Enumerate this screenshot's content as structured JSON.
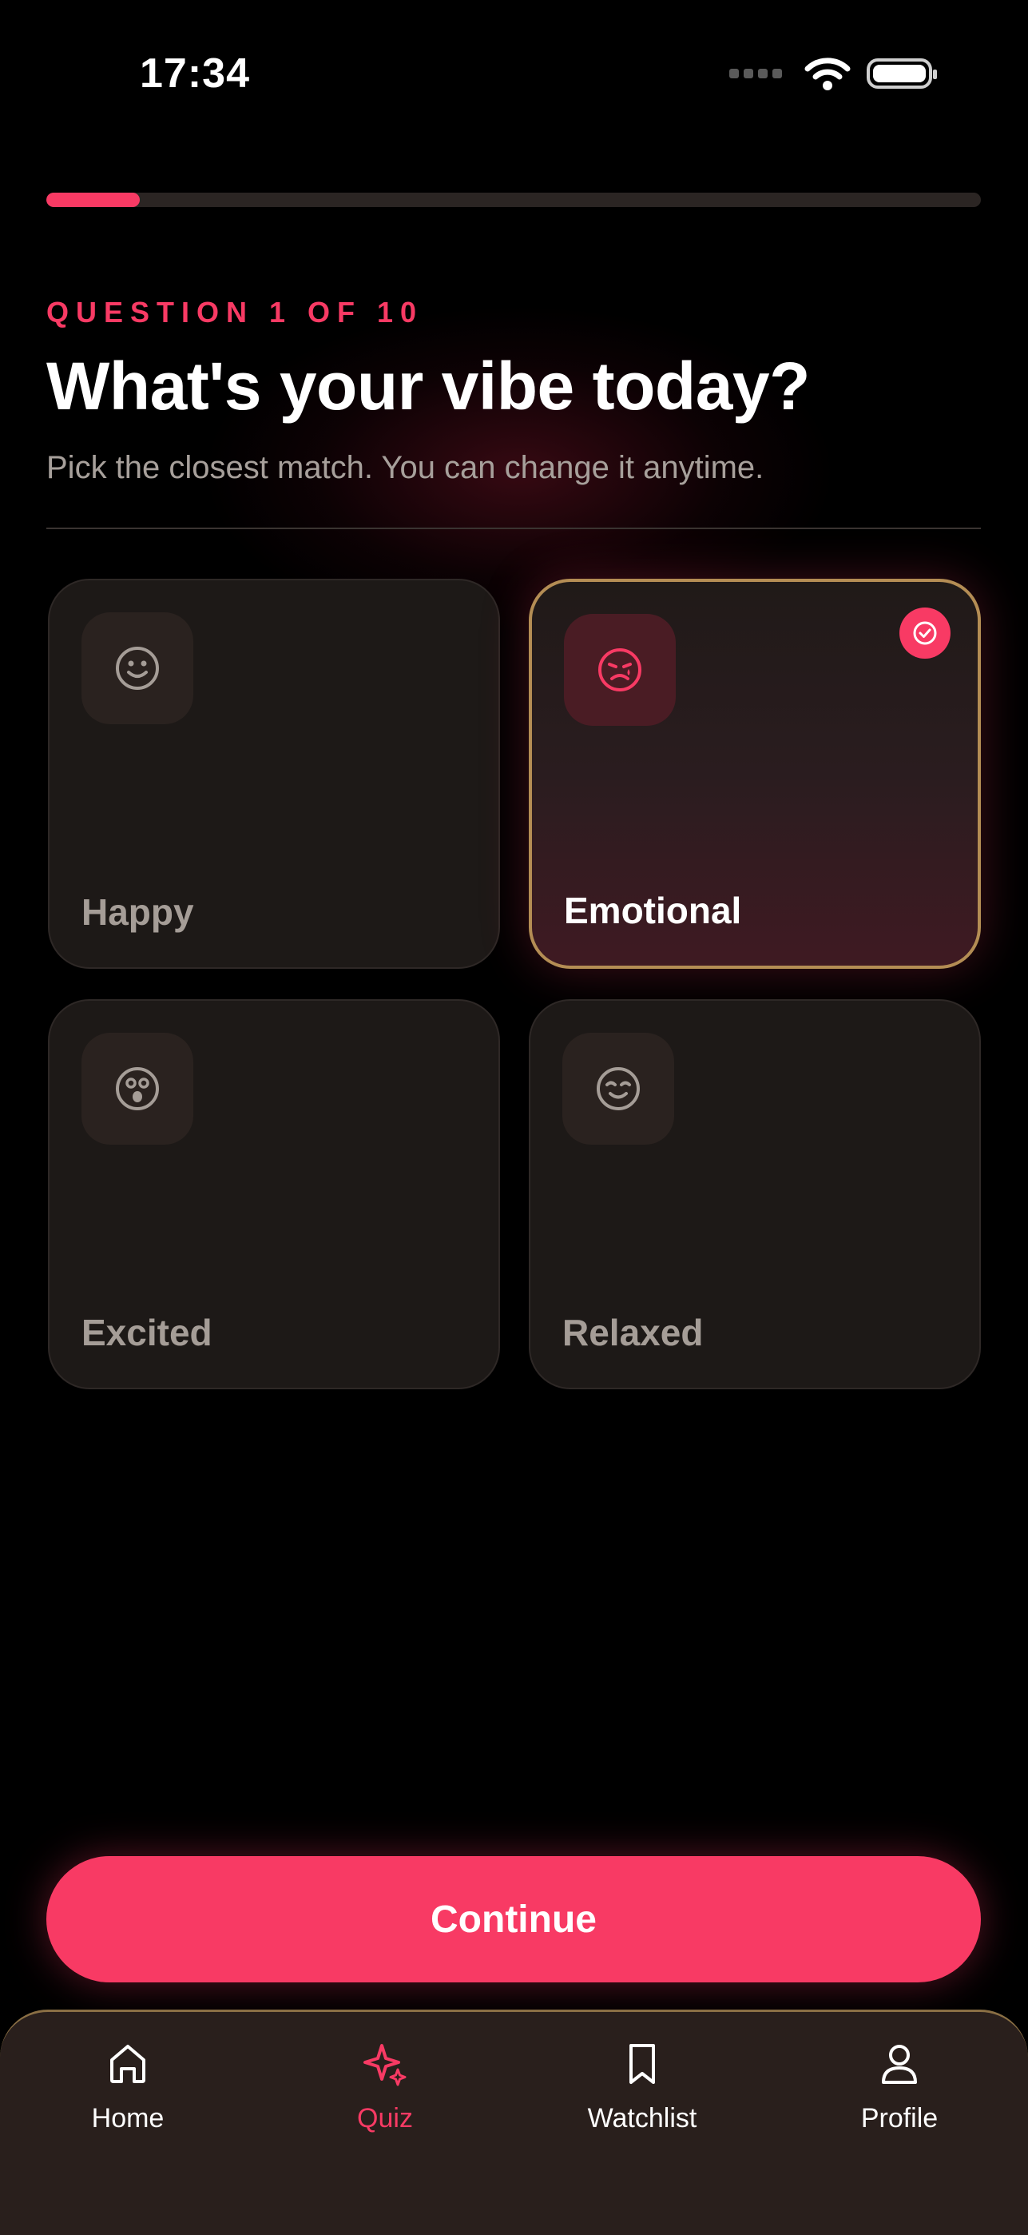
{
  "status_bar": {
    "time": "17:34"
  },
  "progress": {
    "current": 1,
    "total": 10,
    "fraction": 0.1
  },
  "question": {
    "eyebrow": "QUESTION 1 OF 10",
    "title": "What's your vibe today?",
    "subtitle": "Pick the closest match. You can change it anytime."
  },
  "options": [
    {
      "label": "Happy",
      "icon": "smile-icon",
      "selected": false
    },
    {
      "label": "Emotional",
      "icon": "sad-face-icon",
      "selected": true
    },
    {
      "label": "Excited",
      "icon": "surprised-face-icon",
      "selected": false
    },
    {
      "label": "Relaxed",
      "icon": "content-face-icon",
      "selected": false
    }
  ],
  "continue_label": "Continue",
  "tabs": [
    {
      "label": "Home",
      "icon": "home-icon",
      "active": false
    },
    {
      "label": "Quiz",
      "icon": "sparkle-icon",
      "active": true
    },
    {
      "label": "Watchlist",
      "icon": "bookmark-icon",
      "active": false
    },
    {
      "label": "Profile",
      "icon": "person-icon",
      "active": false
    }
  ],
  "colors": {
    "accent": "#f83a64",
    "background": "#000000",
    "card": "#1d1917",
    "selected_border": "#b48d54",
    "tabbar": "#291f1c"
  }
}
